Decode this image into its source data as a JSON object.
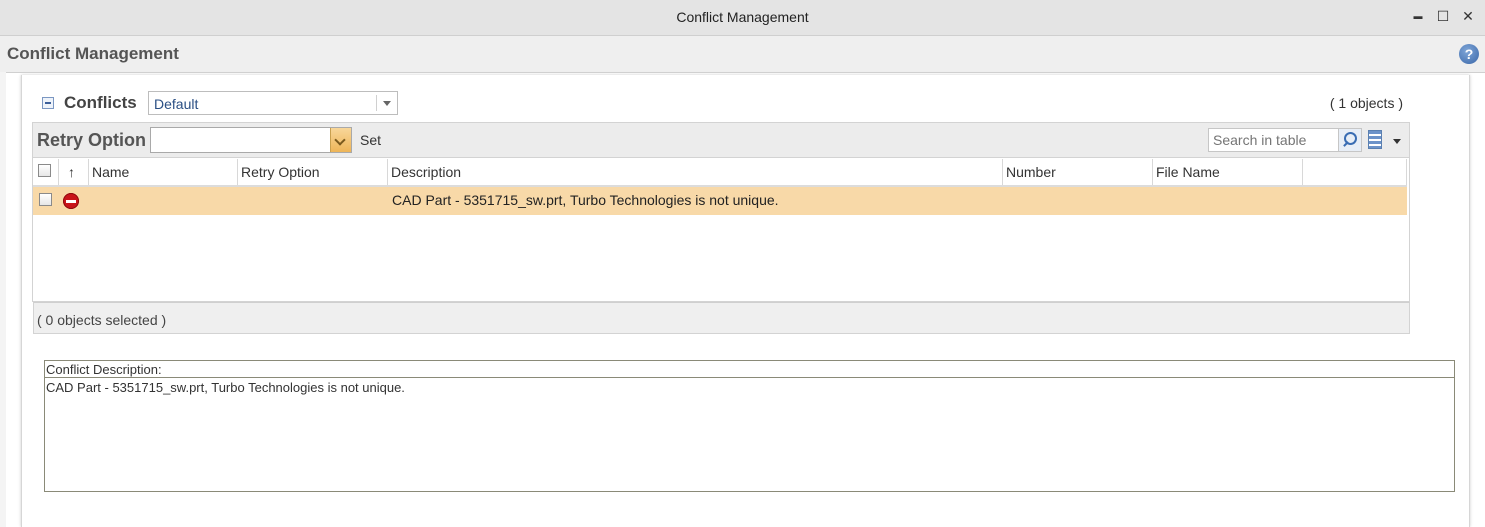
{
  "window": {
    "title": "Conflict Management",
    "minimize_glyph": "▬",
    "maximize_glyph": "☐",
    "close_glyph": "✕"
  },
  "header": {
    "title": "Conflict Management",
    "help_glyph": "?"
  },
  "conflicts": {
    "title": "Conflicts",
    "view_selected": "Default",
    "object_count": "( 1 objects )"
  },
  "toolbar": {
    "retry_label": "Retry Option",
    "retry_value": "",
    "set_label": "Set",
    "search_placeholder": "Search in table"
  },
  "table": {
    "sort_glyph": "↑",
    "columns": [
      "Name",
      "Retry Option",
      "Description",
      "Number",
      "File Name"
    ],
    "rows": [
      {
        "status_icon": "error-icon",
        "name": "",
        "retry_option": "",
        "description": "CAD Part  - 5351715_sw.prt, Turbo Technologies is not unique.",
        "number": "",
        "file_name": ""
      }
    ],
    "selected_count": "( 0 objects selected )"
  },
  "detail": {
    "label": "Conflict Description:",
    "text": "CAD Part  - 5351715_sw.prt, Turbo Technologies is not unique."
  },
  "colors": {
    "row_highlight": "#f8d9a8",
    "error_red": "#c8141a"
  }
}
